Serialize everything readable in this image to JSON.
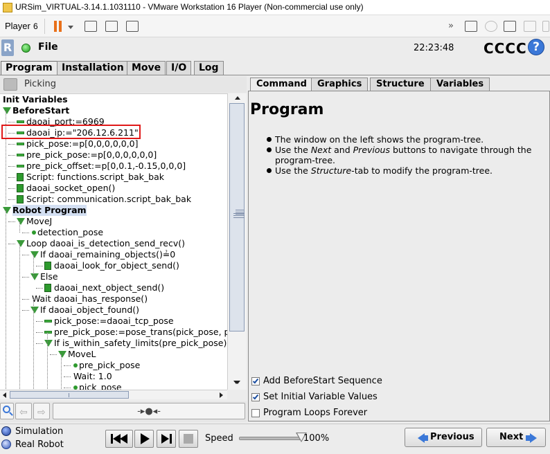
{
  "window": {
    "title": "URSim_VIRTUAL-3.14.1.1031110 - VMware Workstation 16 Player (Non-commercial use only)"
  },
  "vmware_toolbar": {
    "player_label": "Player",
    "player_count": "6"
  },
  "header": {
    "file_label": "File",
    "clock": "22:23:48",
    "robot_name": "CCCC",
    "help_label": "?"
  },
  "main_tabs": [
    {
      "label": "Program",
      "active": true
    },
    {
      "label": "Installation",
      "active": false
    },
    {
      "label": "Move",
      "active": false
    },
    {
      "label": "I/O",
      "active": false
    },
    {
      "label": "Log",
      "active": false
    }
  ],
  "program_name": "Picking",
  "tree": [
    {
      "text": "Init Variables",
      "type": "plain",
      "bold": true
    },
    {
      "text": "BeforeStart",
      "type": "folder",
      "bold": true
    },
    {
      "text": "daoai_port:=6969",
      "type": "assign"
    },
    {
      "text": "daoai_ip:=\"206.12.6.211\"",
      "type": "assign"
    },
    {
      "text": "pick_pose:=p[0,0,0,0,0,0]",
      "type": "assign"
    },
    {
      "text": "pre_pick_pose:=p[0,0,0,0,0,0]",
      "type": "assign"
    },
    {
      "text": "pre_pick_offset:=p[0,0.1,-0.15,0,0,0]",
      "type": "assign"
    },
    {
      "text": "Script: functions.script_bak_bak",
      "type": "script"
    },
    {
      "text": "daoai_socket_open()",
      "type": "script"
    },
    {
      "text": "Script: communication.script_bak_bak",
      "type": "script"
    },
    {
      "text": "Robot Program",
      "type": "folder",
      "bold": true
    },
    {
      "text": "MoveJ",
      "type": "folder"
    },
    {
      "text": "detection_pose",
      "type": "waypoint"
    },
    {
      "text": "Loop daoai_is_detection_send_recv()",
      "type": "folder"
    },
    {
      "text": "If daoai_remaining_objects()≟0",
      "type": "folder"
    },
    {
      "text": "daoai_look_for_object_send()",
      "type": "script"
    },
    {
      "text": "Else",
      "type": "folder"
    },
    {
      "text": "daoai_next_object_send()",
      "type": "script"
    },
    {
      "text": "Wait daoai_has_response()",
      "type": "wait"
    },
    {
      "text": "If daoai_object_found()",
      "type": "folder"
    },
    {
      "text": "pick_pose:=daoai_tcp_pose",
      "type": "assign"
    },
    {
      "text": "pre_pick_pose:=pose_trans(pick_pose, p",
      "type": "assign"
    },
    {
      "text": "If is_within_safety_limits(pre_pick_pose)",
      "type": "folder"
    },
    {
      "text": "MoveL",
      "type": "folder"
    },
    {
      "text": "pre_pick_pose",
      "type": "waypoint"
    },
    {
      "text": "Wait: 1.0",
      "type": "wait"
    },
    {
      "text": "pick_pose",
      "type": "waypoint"
    }
  ],
  "tree_toolbar": {
    "center_glyph": "-▸●◂-"
  },
  "right_tabs": [
    {
      "label": "Command",
      "active": true
    },
    {
      "label": "Graphics",
      "active": false
    },
    {
      "label": "Structure",
      "active": false
    },
    {
      "label": "Variables",
      "active": false
    }
  ],
  "command": {
    "heading": "Program",
    "bullets": [
      [
        "The window on the left shows the program-tree.",
        "",
        ""
      ],
      [
        "Use the ",
        "Next",
        " and ",
        "Previous",
        " buttons to navigate through the program-tree."
      ],
      [
        "Use the ",
        "Structure",
        "-tab to modify the program-tree."
      ]
    ],
    "checkboxes": [
      {
        "label": "Add BeforeStart Sequence",
        "checked": true
      },
      {
        "label": "Set Initial Variable Values",
        "checked": true
      },
      {
        "label": "Program Loops Forever",
        "checked": false
      }
    ]
  },
  "footer": {
    "mode_simulation": "Simulation",
    "mode_real_robot": "Real Robot",
    "selected_mode": "Simulation",
    "speed_label": "Speed",
    "speed_value": "100%",
    "speed_fraction": 1.0,
    "previous_label": "Previous",
    "next_label": "Next"
  },
  "colors": {
    "tree_green": "#3a9a3a",
    "highlight_box": "#e01818",
    "selection": "#d3dff2",
    "accent_blue": "#3b78d8"
  }
}
